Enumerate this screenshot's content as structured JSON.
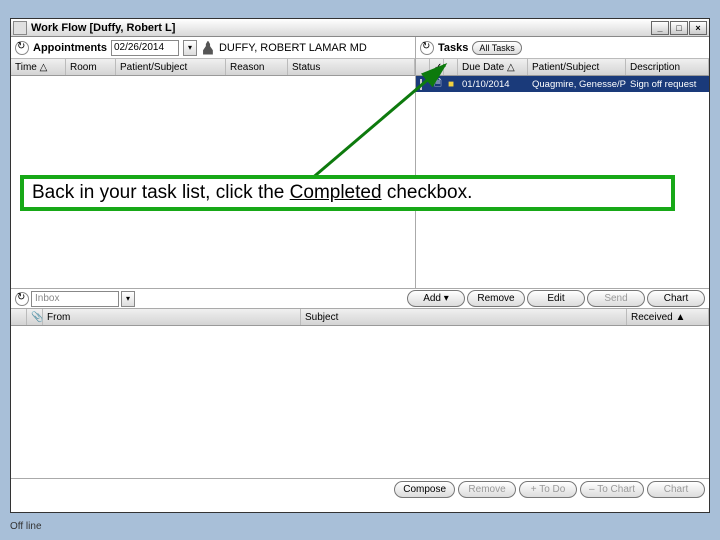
{
  "window": {
    "title": "Work Flow [Duffy, Robert L]"
  },
  "appointments": {
    "label": "Appointments",
    "date": "02/26/2014",
    "provider": "DUFFY, ROBERT LAMAR MD",
    "columns": {
      "time": "Time △",
      "room": "Room",
      "patient": "Patient/Subject",
      "reason": "Reason",
      "status": "Status"
    }
  },
  "tasks": {
    "label": "Tasks",
    "filter": "All Tasks",
    "columns": {
      "due": "Due Date △",
      "patient": "Patient/Subject",
      "desc": "Description"
    },
    "row": {
      "due": "01/10/2014",
      "patient": "Quagmire, Genesse/P…",
      "desc": "Sign off request"
    }
  },
  "callout": {
    "pre": "Back in your task list, click the ",
    "underline": "Completed",
    "post": " checkbox."
  },
  "midbar": {
    "inbox": "Inbox",
    "add": "Add",
    "remove": "Remove",
    "edit": "Edit",
    "send": "Send",
    "chart": "Chart"
  },
  "inbox": {
    "columns": {
      "from": "From",
      "subject": "Subject",
      "received": "Received ▲"
    }
  },
  "bottom": {
    "compose": "Compose",
    "remove": "Remove",
    "todo": "+ To Do",
    "tochart": "– To Chart",
    "chart": "Chart"
  },
  "status": "Off line"
}
